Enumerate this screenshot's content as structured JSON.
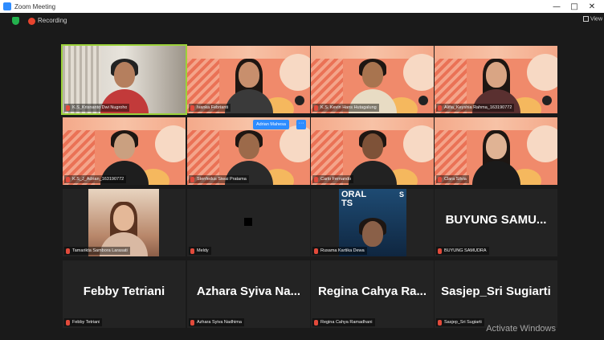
{
  "window": {
    "title": "Zoom Meeting",
    "controls": [
      "—",
      "□",
      "✕"
    ]
  },
  "meeting_bar": {
    "recording_label": "Recording",
    "view_label": "View"
  },
  "pin_popup": {
    "label": "Adrian Mahesa",
    "more": "···"
  },
  "tiles": [
    {
      "name": "K.S_Krisnanto Dwi Nugroho",
      "big": ""
    },
    {
      "name": "Ivanka Febrianti",
      "big": ""
    },
    {
      "name": "K.S. Kevin Hans Hutagalung",
      "big": ""
    },
    {
      "name": "Alifia_Keyshia Rahma_163190772",
      "big": ""
    },
    {
      "name": "K.S_J_Adrian_163190772",
      "big": ""
    },
    {
      "name": "Stenfedus Siwai Pratama",
      "big": ""
    },
    {
      "name": "Carlo Fernando",
      "big": ""
    },
    {
      "name": "Clara Silvia",
      "big": ""
    },
    {
      "name": "Tamarikta Sambora Larasati",
      "big": ""
    },
    {
      "name": "Meldy",
      "big": ""
    },
    {
      "name": "Rusama Kartika Dewa",
      "big": ""
    },
    {
      "name": "BUYUNG SAMUDRA",
      "big": "BUYUNG SAMU..."
    },
    {
      "name": "Febby Tetriani",
      "big": "Febby Tetriani"
    },
    {
      "name": "Azhara Syiva Nadhima",
      "big": "Azhara Syiva Na..."
    },
    {
      "name": "Regina Cahya Ramadhani",
      "big": "Regina Cahya Ra..."
    },
    {
      "name": "Sasjep_Sri Sugiarti",
      "big": "Sasjep_Sri Sugiarti"
    }
  ],
  "screen_share_text": {
    "left": "ORAL\nTS",
    "right": "S"
  },
  "watermark": "Activate Windows"
}
